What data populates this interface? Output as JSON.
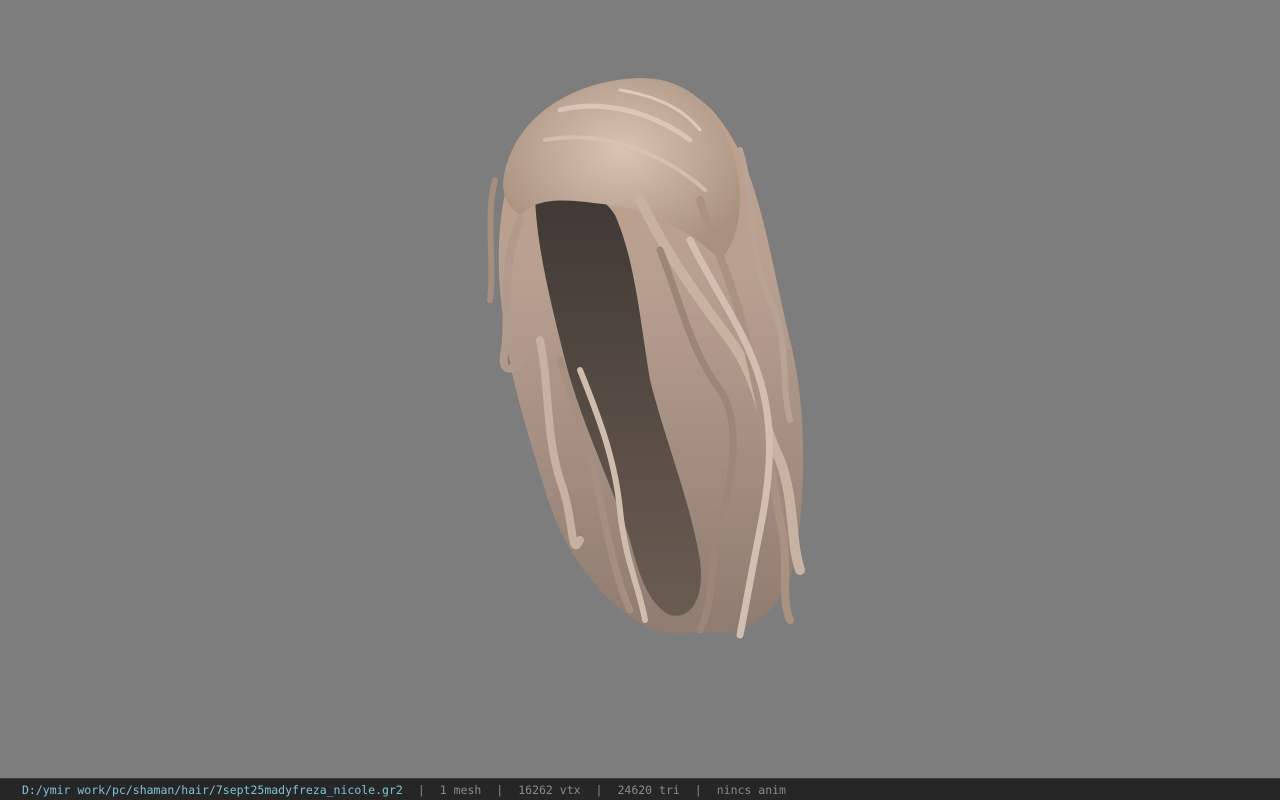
{
  "viewer": {
    "background_color": "#7d7d7d",
    "model": {
      "name": "hair-mesh",
      "base_color": "#b59e8e",
      "shadow_color": "#4f4540",
      "highlight_color": "#dcc7b8"
    }
  },
  "status_bar": {
    "file_path": "D:/ymir work/pc/shaman/hair/7sept25madyfreza_nicole.gr2",
    "separator": "|",
    "mesh_count": "1 mesh",
    "vertex_count": "16262 vtx",
    "triangle_count": "24620 tri",
    "anim_status": "nincs anim",
    "path_color": "#7fc4d6",
    "text_color": "#8a8a8a",
    "background_color": "#262626"
  }
}
